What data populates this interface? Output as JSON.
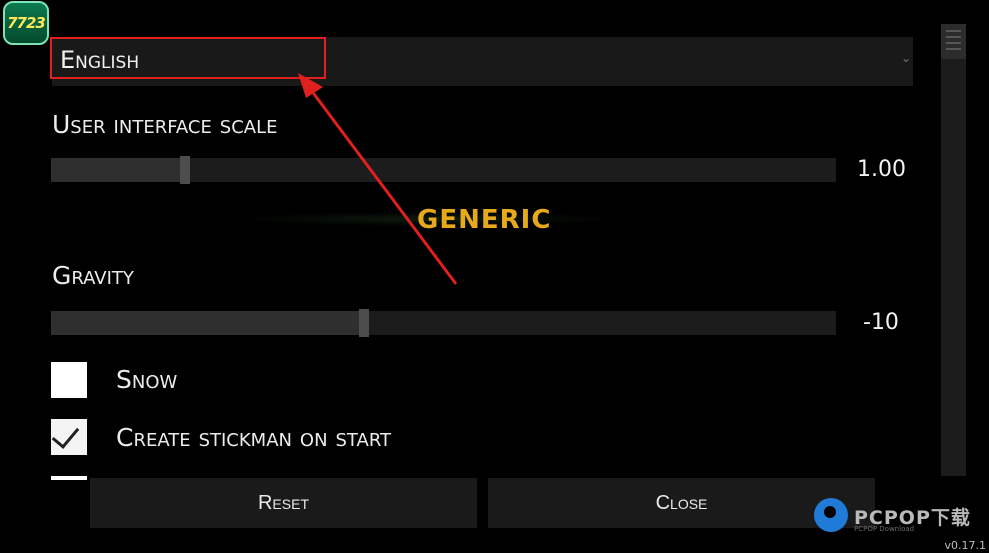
{
  "logo": {
    "text": "7723"
  },
  "language": {
    "selected": "English"
  },
  "ui_scale": {
    "label": "User interface scale",
    "value_text": "1.00",
    "position": 0.171
  },
  "watermark": {
    "text": "GENERIC"
  },
  "gravity": {
    "label": "Gravity",
    "value_text": "-10",
    "position": 0.399
  },
  "options": [
    {
      "label": "Snow",
      "checked": false
    },
    {
      "label": "Create stickman on start",
      "checked": true
    }
  ],
  "buttons": {
    "reset": "Reset",
    "close": "Close"
  },
  "branding": {
    "name": "PCPOP下载",
    "sub": "PCPOP Download"
  },
  "version": "v0.17.1",
  "colors": {
    "annotation": "#e0201c",
    "watermark": "#e6a91c",
    "background": "#000000"
  }
}
